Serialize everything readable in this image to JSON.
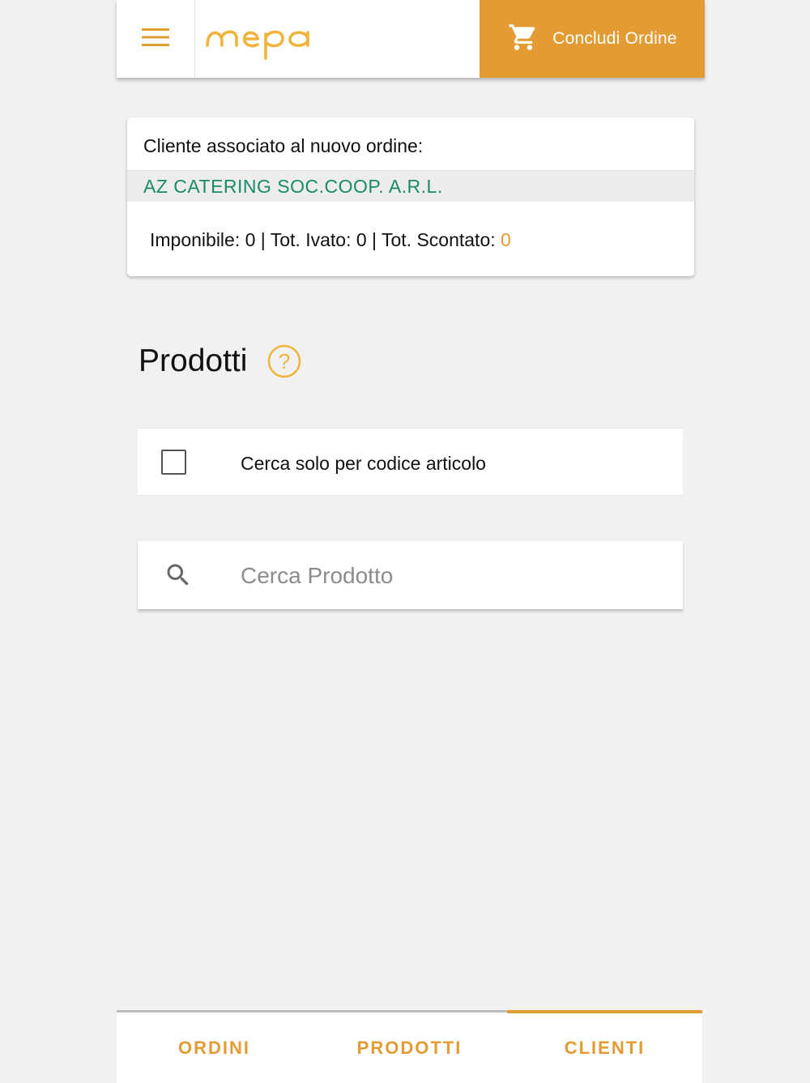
{
  "header": {
    "logo_text": "mepa",
    "conclude_label": "Concludi Ordine",
    "icons": [
      "menu-icon",
      "cart-icon"
    ]
  },
  "client_card": {
    "title": "Cliente associato al nuovo ordine:",
    "client_name": "AZ CATERING SOC.COOP. A.R.L.",
    "totals_prefix": "Imponibile: 0 | Tot. Ivato: 0 | Tot. Scontato: ",
    "scontato_value": "0"
  },
  "products": {
    "heading": "Prodotti",
    "help_symbol": "?",
    "code_only_label": "Cerca solo per codice articolo",
    "code_only_checked": false,
    "search_placeholder": "Cerca Prodotto",
    "search_value": ""
  },
  "tabs": [
    {
      "label": "ORDINI",
      "active": false
    },
    {
      "label": "PRODOTTI",
      "active": false
    },
    {
      "label": "CLIENTI",
      "active": true
    }
  ],
  "colors": {
    "accent": "#e39b33",
    "client_name": "#1a8a6b",
    "background": "#f1f1f1"
  }
}
